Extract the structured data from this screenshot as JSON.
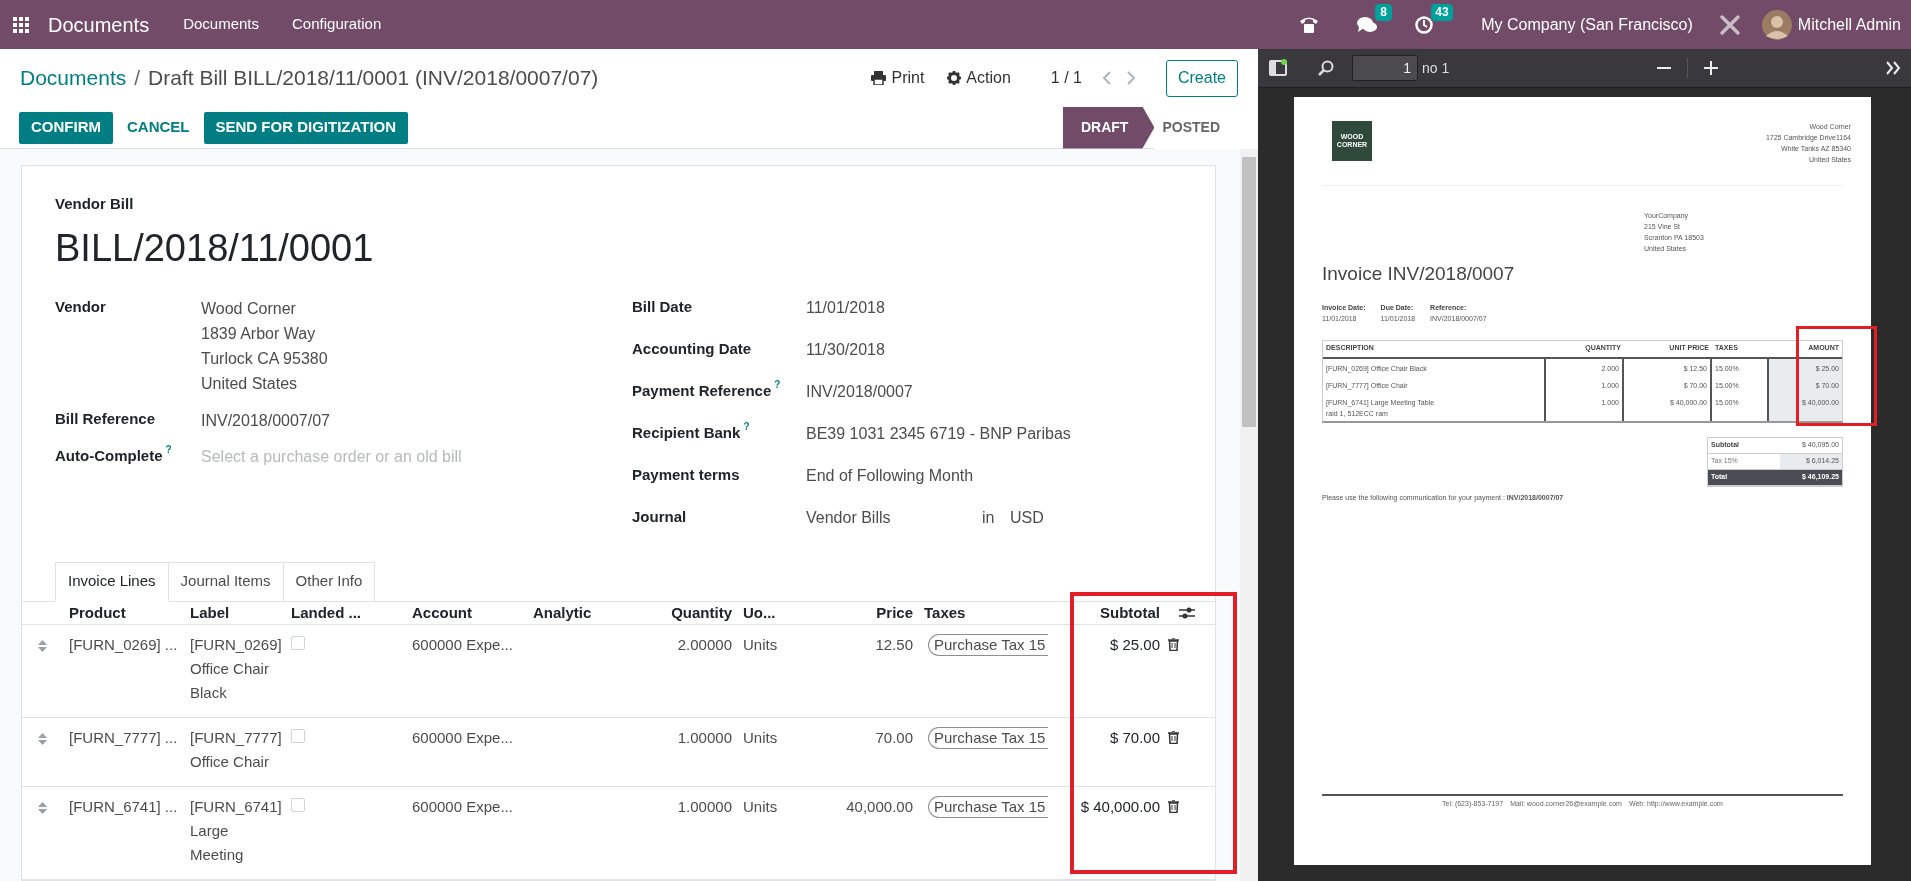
{
  "navbar": {
    "app": "Documents",
    "menu": [
      "Documents",
      "Configuration"
    ],
    "messages_count": "8",
    "activities_count": "43",
    "company": "My Company (San Francisco)",
    "user": "Mitchell Admin"
  },
  "breadcrumb": {
    "parent": "Documents",
    "separator": "/",
    "current": "Draft Bill BILL/2018/11/0001 (INV/2018/0007/07)"
  },
  "toolbar": {
    "print": "Print",
    "action": "Action",
    "pager": "1 / 1",
    "create": "Create"
  },
  "actions": [
    {
      "label": "CONFIRM",
      "kind": "primary"
    },
    {
      "label": "CANCEL",
      "kind": "secondary"
    },
    {
      "label": "SEND FOR DIGITIZATION",
      "kind": "primary"
    }
  ],
  "status_stages": [
    {
      "label": "DRAFT",
      "selected": true
    },
    {
      "label": "POSTED",
      "selected": false
    }
  ],
  "form": {
    "type_label": "Vendor Bill",
    "name": "BILL/2018/11/0001",
    "left_fields": [
      {
        "label": "Vendor",
        "lines": [
          "Wood Corner",
          "1839 Arbor Way",
          "Turlock CA 95380",
          "United States"
        ]
      },
      {
        "label": "Bill Reference",
        "lines": [
          "INV/2018/0007/07"
        ]
      },
      {
        "label": "Auto-Complete",
        "help": "?",
        "placeholder": "Select a purchase order or an old bill"
      }
    ],
    "right_fields": [
      {
        "label": "Bill Date",
        "value": "11/01/2018"
      },
      {
        "label": "Accounting Date",
        "value": "11/30/2018"
      },
      {
        "label": "Payment Reference",
        "help": "?",
        "value": "INV/2018/0007"
      },
      {
        "label": "Recipient Bank",
        "help": "?",
        "value": "BE39 1031 2345 6719 - BNP Paribas"
      },
      {
        "label": "Payment terms",
        "value": "End of Following Month"
      },
      {
        "label": "Journal",
        "value": "Vendor Bills",
        "connector": "in",
        "currency": "USD"
      }
    ]
  },
  "tabs": [
    {
      "label": "Invoice Lines",
      "selected": true
    },
    {
      "label": "Journal Items",
      "selected": false
    },
    {
      "label": "Other Info",
      "selected": false
    }
  ],
  "lines_table": {
    "columns": [
      {
        "label": "Product"
      },
      {
        "label": "Label"
      },
      {
        "label": "Landed ..."
      },
      {
        "label": "Account"
      },
      {
        "label": "Analytic"
      },
      {
        "label": "Quantity"
      },
      {
        "label": "Uo..."
      },
      {
        "label": "Price"
      },
      {
        "label": "Taxes"
      },
      {
        "label": "Subtotal",
        "highlighted": true
      }
    ],
    "rows": [
      {
        "product": "[FURN_0269] ...",
        "label": "[FURN_0269] Office Chair Black",
        "landed_costs": false,
        "account": "600000 Expe...",
        "quantity": "2.00000",
        "uom": "Units",
        "price": "12.50",
        "tax": "Purchase Tax 15",
        "subtotal": "$ 25.00"
      },
      {
        "product": "[FURN_7777] ...",
        "label": "[FURN_7777] Office Chair",
        "landed_costs": false,
        "account": "600000 Expe...",
        "quantity": "1.00000",
        "uom": "Units",
        "price": "70.00",
        "tax": "Purchase Tax 15",
        "subtotal": "$ 70.00"
      },
      {
        "product": "[FURN_6741] ...",
        "label": "[FURN_6741] Large Meeting",
        "landed_costs": false,
        "account": "600000 Expe...",
        "quantity": "1.00000",
        "uom": "Units",
        "price": "40,000.00",
        "tax": "Purchase Tax 15",
        "subtotal": "$ 40,000.00"
      }
    ]
  },
  "pdf_viewer": {
    "page_number": "1",
    "page_count": "no 1",
    "page": {
      "logo_text": "WOOD CORNER",
      "company_lines": [
        "Wood Corner",
        "1725 Cambridge Drive1164",
        "White Tanks AZ 85340",
        "United States"
      ],
      "customer_lines": [
        "YourCompany",
        "215 Vine St",
        "Scranton PA 18503",
        "United States"
      ],
      "title": "Invoice INV/2018/0007",
      "info": [
        {
          "label": "Invoice Date:",
          "value": "11/01/2018"
        },
        {
          "label": "Due Date:",
          "value": "11/01/2018"
        },
        {
          "label": "Reference:",
          "value": "INV/2018/0007/07"
        }
      ],
      "columns": [
        {
          "label": "DESCRIPTION"
        },
        {
          "label": "QUANTITY"
        },
        {
          "label": "UNIT PRICE"
        },
        {
          "label": "TAXES"
        },
        {
          "label": "AMOUNT",
          "highlighted": true
        }
      ],
      "rows": [
        {
          "description": [
            "[FURN_0269] Office Chair Black"
          ],
          "quantity": "2.000",
          "unit_price": "$ 12.50",
          "taxes": "15.00%",
          "amount": "$ 25.00"
        },
        {
          "description": [
            "[FURN_7777] Office Chair"
          ],
          "quantity": "1.000",
          "unit_price": "$ 70.00",
          "taxes": "15.00%",
          "amount": "$ 70.00"
        },
        {
          "description": [
            "[FURN_6741] Large Meeting Table",
            "raid 1, 512ECC ram"
          ],
          "quantity": "1.000",
          "unit_price": "$ 40,000.00",
          "taxes": "15.00%",
          "amount": "$ 40,000.00"
        }
      ],
      "totals": [
        {
          "label": "Subtotal",
          "value": "$ 40,095.00",
          "kind": "subtotal"
        },
        {
          "label": "Tax 15%",
          "value": "$ 6,014.25",
          "kind": "tax"
        },
        {
          "label": "Total",
          "value": "$ 46,109.25",
          "kind": "total"
        }
      ],
      "communication": "Please use the following communication for your payment : **INV/2018/0007/07**",
      "footer": [
        "Tel: (623)-853-7197",
        "Mail: wood.corner26@example.com",
        "Web: http://www.example.com"
      ]
    }
  }
}
